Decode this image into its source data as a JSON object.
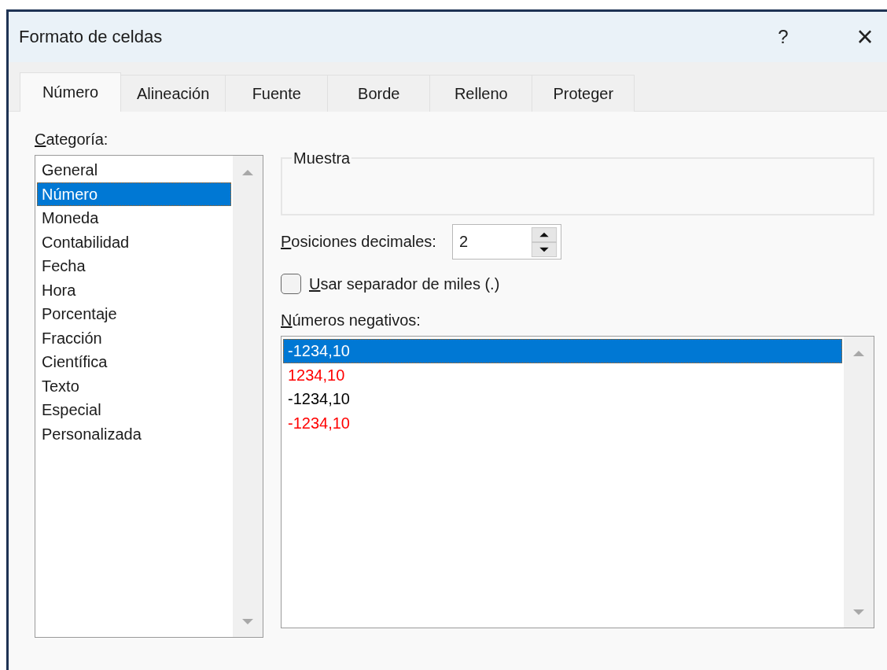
{
  "window": {
    "title": "Formato de celdas",
    "help_button": "?",
    "close_button": "×"
  },
  "tabs": [
    {
      "label": "Número",
      "selected": true
    },
    {
      "label": "Alineación",
      "selected": false
    },
    {
      "label": "Fuente",
      "selected": false
    },
    {
      "label": "Borde",
      "selected": false
    },
    {
      "label": "Relleno",
      "selected": false
    },
    {
      "label": "Proteger",
      "selected": false
    }
  ],
  "category": {
    "label": "Categoría:",
    "mnemonic": true,
    "items": [
      {
        "label": "General",
        "selected": false
      },
      {
        "label": "Número",
        "selected": true
      },
      {
        "label": "Moneda",
        "selected": false
      },
      {
        "label": "Contabilidad",
        "selected": false
      },
      {
        "label": "Fecha",
        "selected": false
      },
      {
        "label": "Hora",
        "selected": false
      },
      {
        "label": "Porcentaje",
        "selected": false
      },
      {
        "label": "Fracción",
        "selected": false
      },
      {
        "label": "Científica",
        "selected": false
      },
      {
        "label": "Texto",
        "selected": false
      },
      {
        "label": "Especial",
        "selected": false
      },
      {
        "label": "Personalizada",
        "selected": false
      }
    ]
  },
  "sample": {
    "label": "Muestra"
  },
  "decimal_places": {
    "label": "Posiciones decimales:",
    "mnemonic": true,
    "value": "2"
  },
  "thousands_separator": {
    "label": "Usar separador de miles (.)",
    "mnemonic": true,
    "checked": false
  },
  "negative_numbers": {
    "label": "Números negativos:",
    "mnemonic": true,
    "items": [
      {
        "text": "-1234,10",
        "selected": true
      },
      {
        "text": "1234,10",
        "selected": false,
        "color": "#ff0000"
      },
      {
        "text": "-1234,10",
        "selected": false,
        "color": "#000000"
      },
      {
        "text": "-1234,10",
        "selected": false,
        "color": "#ff0000"
      }
    ]
  }
}
